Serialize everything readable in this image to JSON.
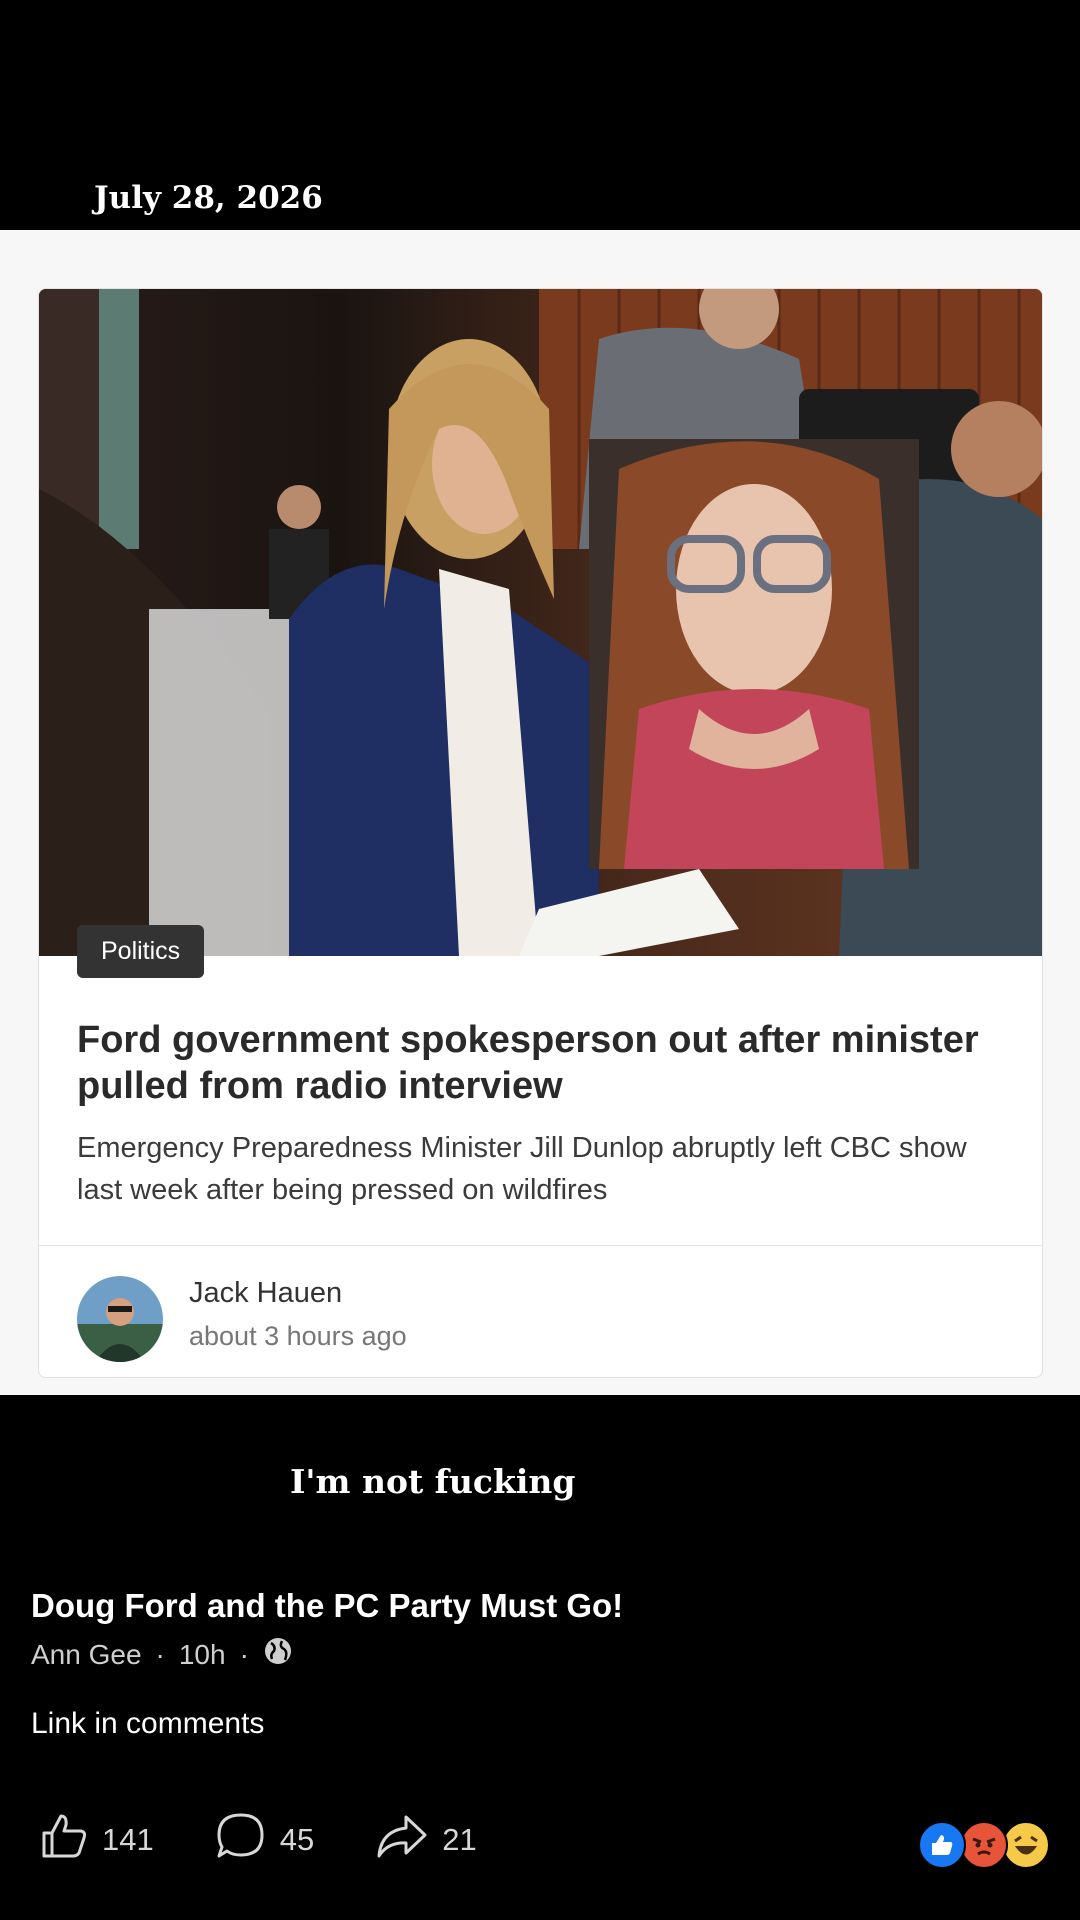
{
  "caption": {
    "date": "July 28, 2026",
    "overlay": "I'm not fucking"
  },
  "article": {
    "category": "Politics",
    "headline": "Ford government spokesperson out after minister pulled from radio interview",
    "subheadline": "Emergency Preparedness Minister Jill Dunlop abruptly left CBC show last week after being pressed on wildfires",
    "author": "Jack Hauen",
    "time": "about 3 hours ago"
  },
  "post": {
    "group": "Doug Ford and the PC Party Must Go!",
    "author": "Ann Gee",
    "time": "10h",
    "separator": "·",
    "body": "Link in comments"
  },
  "actions": {
    "likes": "141",
    "comments": "45",
    "shares": "21"
  },
  "colors": {
    "like_blue": "#1877f2",
    "angry_red": "#e8543a",
    "haha_yellow": "#f7c948"
  }
}
